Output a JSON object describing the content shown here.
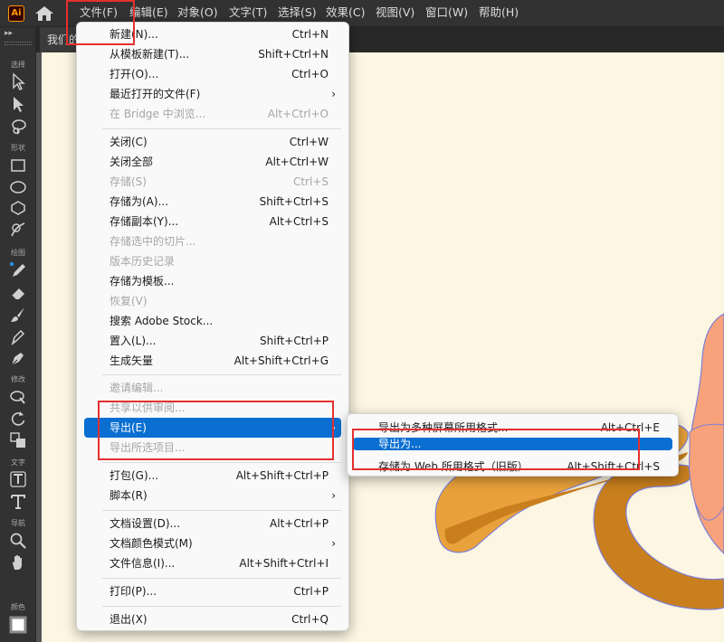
{
  "app": {
    "logo": "Ai"
  },
  "menubar": [
    "文件(F)",
    "编辑(E)",
    "对象(O)",
    "文字(T)",
    "选择(S)",
    "效果(C)",
    "视图(V)",
    "窗口(W)",
    "帮助(H)"
  ],
  "document": {
    "tab_title": "我们的"
  },
  "toolbar": {
    "categories": {
      "select": "选择",
      "shape": "形状",
      "draw": "绘图",
      "modify": "修改",
      "type": "文字",
      "navigate": "导航",
      "color": "颜色"
    },
    "icons": [
      "selection-tool-icon",
      "direct-selection-tool-icon",
      "lasso-tool-icon",
      "rectangle-tool-icon",
      "ellipse-tool-icon",
      "polygon-tool-icon",
      "shaper-tool-icon",
      "pencil-tool-icon",
      "eraser-tool-icon",
      "paintbrush-tool-icon",
      "blob-brush-tool-icon",
      "pen-tool-icon",
      "warp-tool-icon",
      "rotate-tool-icon",
      "scale-tool-icon",
      "touch-type-tool-icon",
      "type-tool-icon",
      "zoom-tool-icon",
      "hand-tool-icon",
      "fill-stroke-icon"
    ]
  },
  "file_menu": {
    "items": [
      {
        "label": "新建(N)...",
        "shortcut": "Ctrl+N"
      },
      {
        "label": "从模板新建(T)...",
        "shortcut": "Shift+Ctrl+N"
      },
      {
        "label": "打开(O)...",
        "shortcut": "Ctrl+O"
      },
      {
        "label": "最近打开的文件(F)",
        "shortcut": ""
      },
      {
        "label": "在 Bridge 中浏览...",
        "shortcut": "Alt+Ctrl+O"
      },
      {
        "label": "关闭(C)",
        "shortcut": "Ctrl+W"
      },
      {
        "label": "关闭全部",
        "shortcut": "Alt+Ctrl+W"
      },
      {
        "label": "存储(S)",
        "shortcut": "Ctrl+S"
      },
      {
        "label": "存储为(A)...",
        "shortcut": "Shift+Ctrl+S"
      },
      {
        "label": "存储副本(Y)...",
        "shortcut": "Alt+Ctrl+S"
      },
      {
        "label": "存储选中的切片...",
        "shortcut": ""
      },
      {
        "label": "版本历史记录",
        "shortcut": ""
      },
      {
        "label": "存储为模板...",
        "shortcut": ""
      },
      {
        "label": "恢复(V)",
        "shortcut": ""
      },
      {
        "label": "搜索 Adobe Stock...",
        "shortcut": ""
      },
      {
        "label": "置入(L)...",
        "shortcut": "Shift+Ctrl+P"
      },
      {
        "label": "生成矢量",
        "shortcut": "Alt+Shift+Ctrl+G"
      },
      {
        "label": "邀请编辑...",
        "shortcut": ""
      },
      {
        "label": "共享以供审阅...",
        "shortcut": ""
      },
      {
        "label": "导出(E)",
        "shortcut": ""
      },
      {
        "label": "导出所选项目...",
        "shortcut": ""
      },
      {
        "label": "打包(G)...",
        "shortcut": "Alt+Shift+Ctrl+P"
      },
      {
        "label": "脚本(R)",
        "shortcut": ""
      },
      {
        "label": "文档设置(D)...",
        "shortcut": "Alt+Ctrl+P"
      },
      {
        "label": "文档颜色模式(M)",
        "shortcut": ""
      },
      {
        "label": "文件信息(I)...",
        "shortcut": "Alt+Shift+Ctrl+I"
      },
      {
        "label": "打印(P)...",
        "shortcut": "Ctrl+P"
      },
      {
        "label": "退出(X)",
        "shortcut": "Ctrl+Q"
      }
    ],
    "submenu_arrow": "›"
  },
  "export_submenu": {
    "items": [
      {
        "label": "导出为多种屏幕所用格式...",
        "shortcut": "Alt+Ctrl+E"
      },
      {
        "label": "导出为...",
        "shortcut": ""
      },
      {
        "label": "存储为 Web 所用格式（旧版）...",
        "shortcut": "Alt+Shift+Ctrl+S"
      }
    ]
  },
  "colors": {
    "highlight": "#0a6fd1",
    "annotation_red": "#e5302e",
    "artboard": "#fdf6e3",
    "illustration_orange": "#e9a23b",
    "illustration_dark_orange": "#c97f1e",
    "illustration_peach": "#f8a27c"
  }
}
